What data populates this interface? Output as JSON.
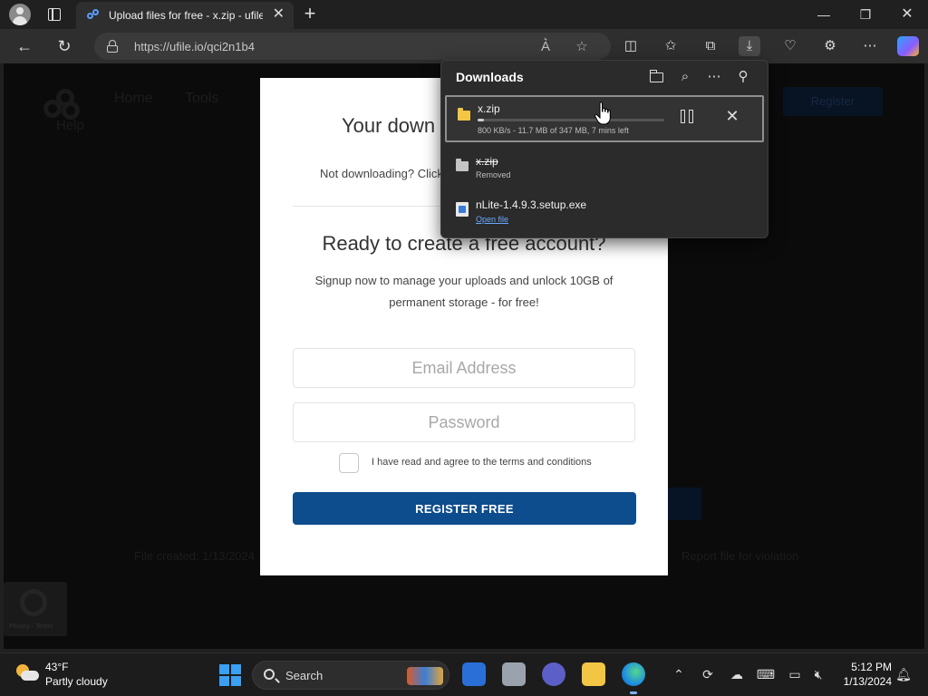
{
  "browser": {
    "tab_title": "Upload files for free - x.zip - ufile.io",
    "url": "https://ufile.io/qci2n1b4"
  },
  "site": {
    "help": "Help",
    "nav": [
      "Home",
      "Tools"
    ],
    "register": "Register",
    "footer_left": "File created: 1/13/2024",
    "footer_right": "Report file for violation",
    "recaptcha": "Privacy - Terms"
  },
  "modal": {
    "title": "Your down",
    "subtitle": "Not downloading? Click",
    "heading": "Ready to create a free account?",
    "body": "Signup now to manage your uploads and unlock 10GB of permanent storage - for free!",
    "email_placeholder": "Email Address",
    "password_placeholder": "Password",
    "terms": "I have read and agree to the terms and conditions",
    "register_button": "REGISTER FREE"
  },
  "downloads": {
    "title": "Downloads",
    "items": [
      {
        "name": "x.zip",
        "status": "800 KB/s - 11.7 MB of 347 MB, 7 mins left",
        "progress": 0.034,
        "state": "active"
      },
      {
        "name": "x.zip",
        "status": "Removed",
        "state": "removed"
      },
      {
        "name": "nLite-1.4.9.3.setup.exe",
        "status": "Open file",
        "state": "complete"
      }
    ]
  },
  "taskbar": {
    "temperature": "43°F",
    "weather": "Partly cloudy",
    "search": "Search",
    "time": "5:12 PM",
    "date": "1/13/2024"
  },
  "colors": {
    "register_button": "#0d4c8d",
    "download_progress": "#cfcfcf",
    "link": "#6aa8ff"
  }
}
